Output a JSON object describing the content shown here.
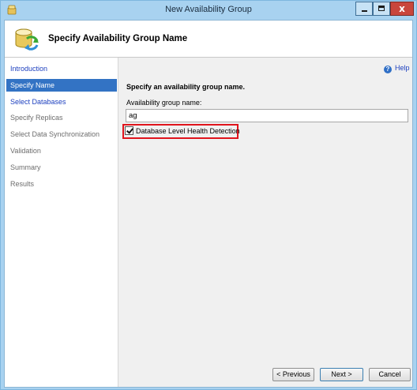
{
  "window": {
    "title": "New Availability Group",
    "close_glyph": "x"
  },
  "header": {
    "title": "Specify Availability Group Name",
    "icon": "database-refresh-icon"
  },
  "nav": {
    "items": [
      {
        "label": "Introduction",
        "state": "link"
      },
      {
        "label": "Specify Name",
        "state": "active"
      },
      {
        "label": "Select Databases",
        "state": "link"
      },
      {
        "label": "Specify Replicas",
        "state": "disabled"
      },
      {
        "label": "Select Data Synchronization",
        "state": "disabled"
      },
      {
        "label": "Validation",
        "state": "disabled"
      },
      {
        "label": "Summary",
        "state": "disabled"
      },
      {
        "label": "Results",
        "state": "disabled"
      }
    ]
  },
  "main": {
    "help_label": "Help",
    "help_glyph": "?",
    "instruction": "Specify an availability group name.",
    "name_label": "Availability group name:",
    "name_value": "ag",
    "health_detection_label": "Database Level Health Detection",
    "health_detection_checked": true
  },
  "footer": {
    "previous_label": "< Previous",
    "next_label": "Next >",
    "cancel_label": "Cancel"
  },
  "colors": {
    "titlebar": "#a8d2f0",
    "nav_active": "#3373c4",
    "link": "#1c3fbf",
    "highlight_border": "#e0141c"
  }
}
